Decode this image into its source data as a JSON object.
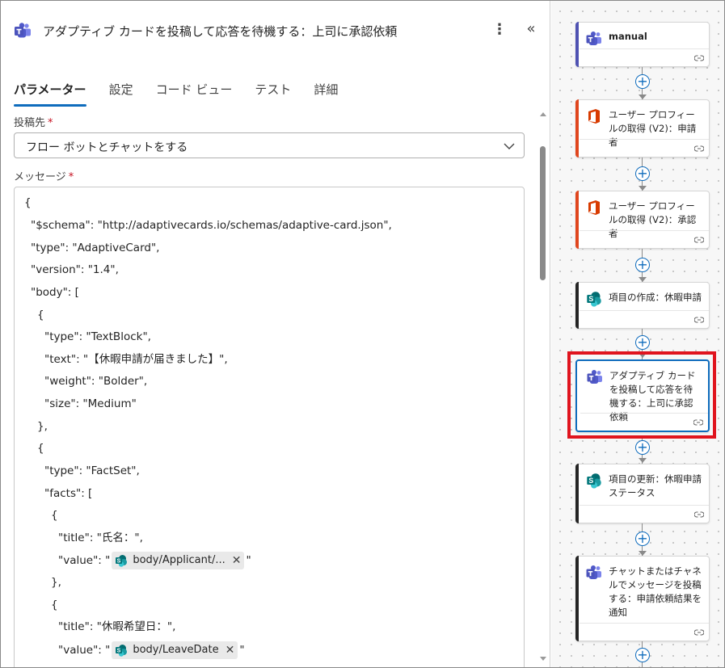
{
  "header": {
    "title": "アダプティブ カードを投稿して応答を待機する：上司に承認依頼",
    "more_label": "⋮",
    "collapse_label": "«"
  },
  "tabs": [
    {
      "label": "パラメーター",
      "active": true
    },
    {
      "label": "設定"
    },
    {
      "label": "コード ビュー"
    },
    {
      "label": "テスト"
    },
    {
      "label": "詳細"
    }
  ],
  "post_as": {
    "label": "投稿先",
    "required_mark": "*",
    "value": "フロー ボットとチャットをする"
  },
  "message": {
    "label": "メッセージ",
    "required_mark": "*",
    "lines": [
      "{",
      "\"$schema\": \"http://adaptivecards.io/schemas/adaptive-card.json\",",
      "\"type\": \"AdaptiveCard\",",
      "\"version\": \"1.4\",",
      "\"body\": [",
      "{",
      "\"type\": \"TextBlock\",",
      "\"text\": \"【休暇申請が届きました】\",",
      "\"weight\": \"Bolder\",",
      "\"size\": \"Medium\"",
      "},",
      "{",
      "\"type\": \"FactSet\",",
      "\"facts\": [",
      "{",
      "\"title\": \"氏名：\",",
      "\"value\": \"",
      "},",
      "{",
      "\"title\": \"休暇希望日：\",",
      "\"value\": \""
    ],
    "tokens": {
      "applicant": "body/Applicant/...",
      "leave_date": "body/LeaveDate",
      "close": "✕",
      "quote": "\""
    }
  },
  "flow": {
    "steps": [
      {
        "label": "manual",
        "icon": "teams-icon",
        "accent": "#4f52b2"
      },
      {
        "label": "ユーザー プロフィールの取得 (V2)：申請者",
        "icon": "office-icon",
        "accent": "#e0461e"
      },
      {
        "label": "ユーザー プロフィールの取得 (V2)：承認者",
        "icon": "office-icon",
        "accent": "#e0461e"
      },
      {
        "label": "項目の作成：休暇申請",
        "icon": "sharepoint-icon",
        "accent": "#242424"
      },
      {
        "label": "アダプティブ カードを投稿して応答を待機する：上司に承認依頼",
        "icon": "teams-icon",
        "accent": "#0f6cbd",
        "selected": true
      },
      {
        "label": "項目の更新：休暇申請ステータス",
        "icon": "sharepoint-icon",
        "accent": "#242424"
      },
      {
        "label": "チャットまたはチャネルでメッセージを投稿する：申請依頼結果を通知",
        "icon": "teams-icon",
        "accent": "#242424"
      }
    ],
    "add_label": "+"
  },
  "colors": {
    "accent": "#0f6cbd",
    "highlight": "#e0141e",
    "office": "#e0461e",
    "teams": "#4f52b2",
    "sharepoint": "#038387"
  }
}
